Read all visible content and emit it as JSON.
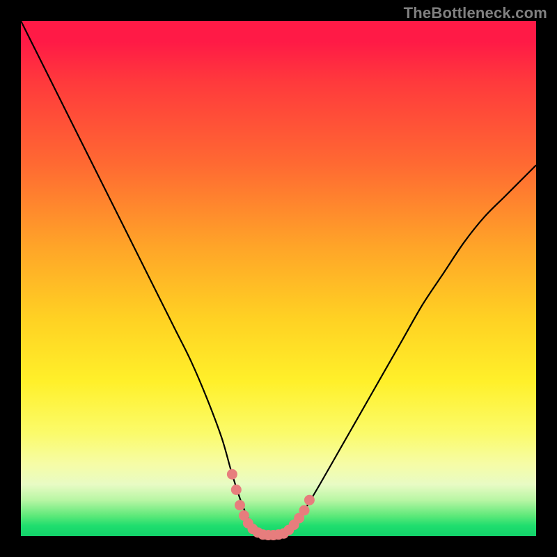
{
  "watermark": "TheBottleneck.com",
  "colors": {
    "background": "#000000",
    "curve_stroke": "#000000",
    "marker_fill": "#e77d7d",
    "gradient_top": "#ff1a46",
    "gradient_bottom": "#12d26a"
  },
  "chart_data": {
    "type": "line",
    "title": "",
    "xlabel": "",
    "ylabel": "",
    "xlim": [
      0,
      100
    ],
    "ylim": [
      0,
      100
    ],
    "grid": false,
    "legend": false,
    "series": [
      {
        "name": "bottleneck-curve",
        "x": [
          0,
          3,
          6,
          9,
          12,
          15,
          18,
          21,
          24,
          27,
          30,
          33,
          36,
          39,
          41,
          43,
          45,
          47,
          49,
          51,
          53,
          55,
          58,
          62,
          66,
          70,
          74,
          78,
          82,
          86,
          90,
          94,
          98,
          100
        ],
        "y": [
          100,
          94,
          88,
          82,
          76,
          70,
          64,
          58,
          52,
          46,
          40,
          34,
          27,
          19,
          12,
          6,
          2,
          0.5,
          0.2,
          0.5,
          2,
          5,
          10,
          17,
          24,
          31,
          38,
          45,
          51,
          57,
          62,
          66,
          70,
          72
        ]
      }
    ],
    "markers": [
      {
        "x": 41.0,
        "y": 12
      },
      {
        "x": 41.8,
        "y": 9
      },
      {
        "x": 42.5,
        "y": 6
      },
      {
        "x": 43.3,
        "y": 4
      },
      {
        "x": 44.1,
        "y": 2.5
      },
      {
        "x": 45.0,
        "y": 1.4
      },
      {
        "x": 46.0,
        "y": 0.7
      },
      {
        "x": 47.0,
        "y": 0.3
      },
      {
        "x": 48.0,
        "y": 0.2
      },
      {
        "x": 49.0,
        "y": 0.2
      },
      {
        "x": 50.0,
        "y": 0.3
      },
      {
        "x": 51.0,
        "y": 0.5
      },
      {
        "x": 52.0,
        "y": 1.2
      },
      {
        "x": 53.0,
        "y": 2.2
      },
      {
        "x": 54.0,
        "y": 3.5
      },
      {
        "x": 55.0,
        "y": 5.0
      },
      {
        "x": 56.0,
        "y": 7.0
      }
    ]
  }
}
